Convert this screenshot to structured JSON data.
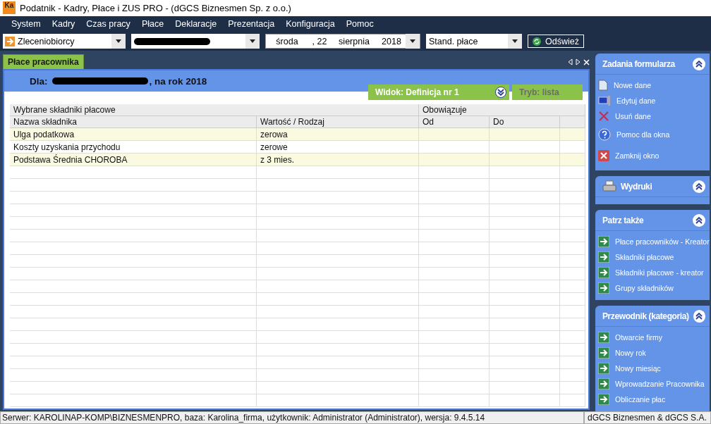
{
  "window": {
    "title": "Podatnik - Kadry, Płace i ZUS PRO - (dGCS Biznesmen Sp. z o.o.)",
    "app_icon": "Ka"
  },
  "menu": [
    "System",
    "Kadry",
    "Czas pracy",
    "Płace",
    "Deklaracje",
    "Prezentacja",
    "Konfiguracja",
    "Pomoc"
  ],
  "toolbar": {
    "group_combo": "Zleceniobiorcy",
    "employee_combo": {
      "redacted": true
    },
    "date": {
      "weekday": "środa",
      "day": ", 22",
      "month": "sierpnia",
      "year": "2018"
    },
    "profile_combo": "Stand. płace",
    "refresh_button": "Odśwież"
  },
  "tabs": [
    {
      "label": "Płace pracownika",
      "selected": true
    }
  ],
  "header": {
    "prefix": "Dla:",
    "redacted": true,
    "suffix": ", na rok 2018",
    "view": "Widok: Definicja nr 1",
    "mode": "Tryb: lista"
  },
  "table": {
    "group_headers": [
      "Wybrane składniki płacowe",
      "Obowiązuje"
    ],
    "columns": [
      "Nazwa składnika",
      "Wartość / Rodzaj",
      "Od",
      "Do"
    ],
    "rows": [
      {
        "cells": [
          "Ulga podatkowa",
          "zerowa",
          "",
          ""
        ],
        "highlighted": true
      },
      {
        "cells": [
          "Koszty uzyskania przychodu",
          "zerowe",
          "",
          ""
        ],
        "highlighted": false
      },
      {
        "cells": [
          "Podstawa Średnia CHOROBA",
          "z 3 mies.",
          "",
          ""
        ],
        "highlighted": true
      }
    ]
  },
  "sidebar": [
    {
      "title": "Zadania formularza",
      "kind": "plain",
      "items": [
        {
          "label": "Nowe dane",
          "kind": "new"
        },
        {
          "label": "Edytuj dane",
          "kind": "edit"
        },
        {
          "label": "Usuń dane",
          "kind": "delete"
        },
        {
          "label": "Pomoc dla okna",
          "kind": "help"
        },
        {
          "label": "Zamknij okno",
          "kind": "close"
        }
      ]
    },
    {
      "title": "Wydruki",
      "kind": "printouts"
    },
    {
      "title": "Patrz także",
      "kind": "plain",
      "items": [
        {
          "label": "Płace pracowników - Kreator",
          "kind": "link"
        },
        {
          "label": "Składniki płacowe",
          "kind": "link"
        },
        {
          "label": "Składniki płacowe - kreator",
          "kind": "link"
        },
        {
          "label": "Grupy składników",
          "kind": "link"
        }
      ]
    },
    {
      "title": "Przewodnik (kategoria)",
      "kind": "plain",
      "items": [
        {
          "label": "Otwarcie firmy",
          "kind": "link"
        },
        {
          "label": "Nowy rok",
          "kind": "link"
        },
        {
          "label": "Nowy miesiąc",
          "kind": "link"
        },
        {
          "label": "Wprowadzanie Pracownika",
          "kind": "link"
        },
        {
          "label": "Obliczanie płac",
          "kind": "link"
        }
      ]
    }
  ],
  "status_bar": [
    "Serwer: KAROLINAP-KOMP\\BIZNESMENPRO, baza: Karolina_firma, użytkownik: Administrator (Administrator), wersja: 9.4.5.14",
    "dGCS Biznesmen & dGCS S.A."
  ]
}
